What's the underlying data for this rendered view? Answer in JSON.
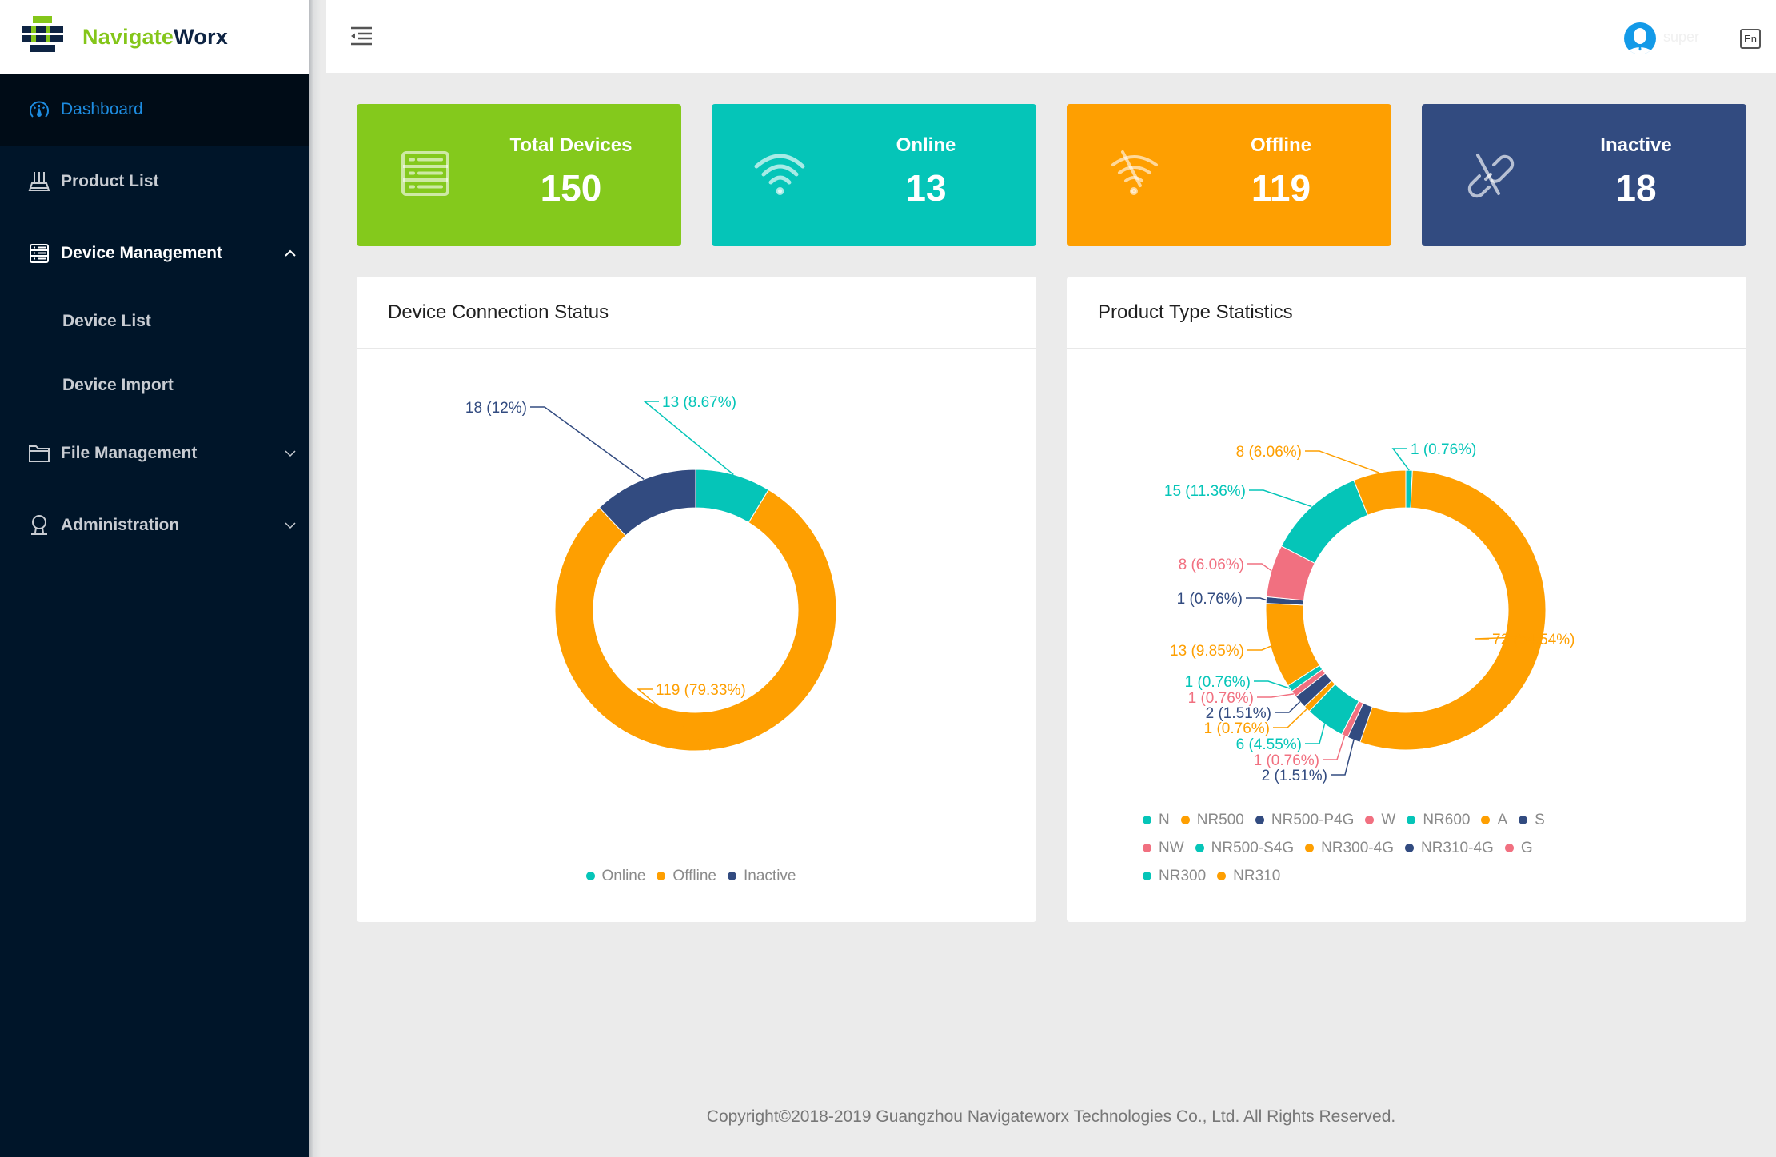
{
  "brand": {
    "name_part1": "Navigate",
    "name_part2": "Worx",
    "color_primary": "#84c61a",
    "color_secondary": "#0e2443"
  },
  "sidebar": {
    "items": [
      {
        "label": "Dashboard",
        "icon": "dashboard-gauge-icon",
        "active": true
      },
      {
        "label": "Product List",
        "icon": "router-icon"
      },
      {
        "label": "Device Management",
        "icon": "device-list-icon",
        "expanded": true,
        "children": [
          {
            "label": "Device List"
          },
          {
            "label": "Device Import"
          }
        ]
      },
      {
        "label": "File Management",
        "icon": "folder-icon",
        "expanded": false
      },
      {
        "label": "Administration",
        "icon": "user-icon",
        "expanded": false
      }
    ]
  },
  "header": {
    "username": "super",
    "language": "En"
  },
  "stats": [
    {
      "label": "Total Devices",
      "value": "150",
      "color": "#84c91c",
      "icon": "server-list-icon"
    },
    {
      "label": "Online",
      "value": "13",
      "color": "#05c5b8",
      "icon": "wifi-icon"
    },
    {
      "label": "Offline",
      "value": "119",
      "color": "#fe9f01",
      "icon": "wifi-off-icon"
    },
    {
      "label": "Inactive",
      "value": "18",
      "color": "#324b80",
      "icon": "unlink-icon"
    }
  ],
  "panels": {
    "connection_title": "Device Connection Status",
    "product_title": "Product Type Statistics"
  },
  "chart_data": [
    {
      "type": "pie",
      "variant": "donut",
      "title": "Device Connection Status",
      "categories": [
        "Online",
        "Offline",
        "Inactive"
      ],
      "values": [
        13,
        119,
        18
      ],
      "labels": [
        "13 (8.67%)",
        "119 (79.33%)",
        "18 (12%)"
      ],
      "colors": [
        "#05c5b8",
        "#fe9f01",
        "#324b80"
      ],
      "legend": "bottom-center"
    },
    {
      "type": "pie",
      "variant": "donut",
      "title": "Product Type Statistics",
      "categories": [
        "N",
        "NR500",
        "NR500-P4G",
        "W",
        "NR600",
        "A",
        "S",
        "NW",
        "NR500-S4G",
        "NR300-4G",
        "NR310-4G",
        "G",
        "NR300",
        "NR310"
      ],
      "values": [
        1,
        72,
        2,
        1,
        6,
        1,
        2,
        1,
        1,
        13,
        1,
        8,
        15,
        8
      ],
      "labels": [
        "1 (0.76%)",
        "72 (54.54%)",
        "2 (1.51%)",
        "1 (0.76%)",
        "6 (4.55%)",
        "1 (0.76%)",
        "2 (1.51%)",
        "1 (0.76%)",
        "1 (0.76%)",
        "13 (9.85%)",
        "1 (0.76%)",
        "8 (6.06%)",
        "15 (11.36%)",
        "8 (6.06%)"
      ],
      "colors": [
        "#05c5b8",
        "#fe9f01",
        "#324b80",
        "#f17080",
        "#05c5b8",
        "#fe9f01",
        "#324b80",
        "#f17080",
        "#05c5b8",
        "#fe9f01",
        "#324b80",
        "#f17080",
        "#05c5b8",
        "#fe9f01"
      ],
      "legend": "bottom-left"
    }
  ],
  "footer": {
    "copyright": "Copyright©2018-2019 Guangzhou Navigateworx Technologies Co., Ltd. All Rights Reserved."
  }
}
